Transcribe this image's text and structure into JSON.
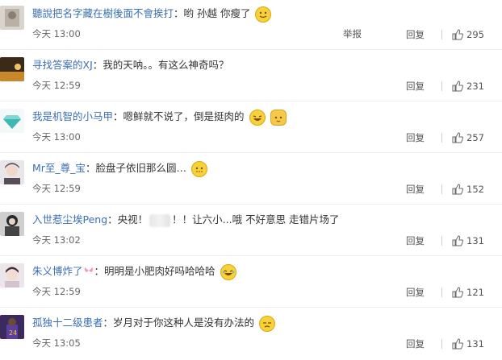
{
  "comments": [
    {
      "user": "聽說把名字藏在樹後面不會挨打",
      "sep": "：",
      "text": "哟 孙越 你瘦了",
      "emoji": "smile",
      "time": "今天 13:00",
      "report": "举报",
      "reply": "回复",
      "likes": "295"
    },
    {
      "user": "寻找答案的XJ",
      "sep": "：",
      "text": "我的天呐。。有这么神奇吗？",
      "time": "今天 12:59",
      "reply": "回复",
      "likes": "231"
    },
    {
      "user": "我是机智的小马甲",
      "sep": "：",
      "text": "嗯鲜就不说了，倒是挺肉的",
      "emoji": "laugh-cat",
      "time": "今天 13:00",
      "reply": "回复",
      "likes": "257"
    },
    {
      "user": "Mr至_尊_宝",
      "sep": "：",
      "text": "脸盘子依旧那么圆…",
      "emoji": "dots",
      "time": "今天 12:59",
      "reply": "回复",
      "likes": "152"
    },
    {
      "user": "入世惹尘埃Peng",
      "sep": "：",
      "text_before": "央视！",
      "text_after": "！！让六小...哦 不好意思 走错片场了",
      "time": "今天 13:02",
      "reply": "回复",
      "likes": "131"
    },
    {
      "user": "朱义博炸了",
      "sep": "：",
      "text": "明明是小肥肉好吗哈哈哈",
      "emoji": "laugh",
      "time": "今天 12:59",
      "reply": "回复",
      "likes": "121"
    },
    {
      "user": "孤独十二级患者",
      "sep": "：",
      "text": "岁月对于你这种人是没有办法的",
      "emoji": "sigh",
      "time": "今天 13:05",
      "reply": "回复",
      "likes": "131"
    }
  ],
  "colors": {
    "username": "#3a6fb5",
    "text": "#333333",
    "meta": "#666666"
  }
}
